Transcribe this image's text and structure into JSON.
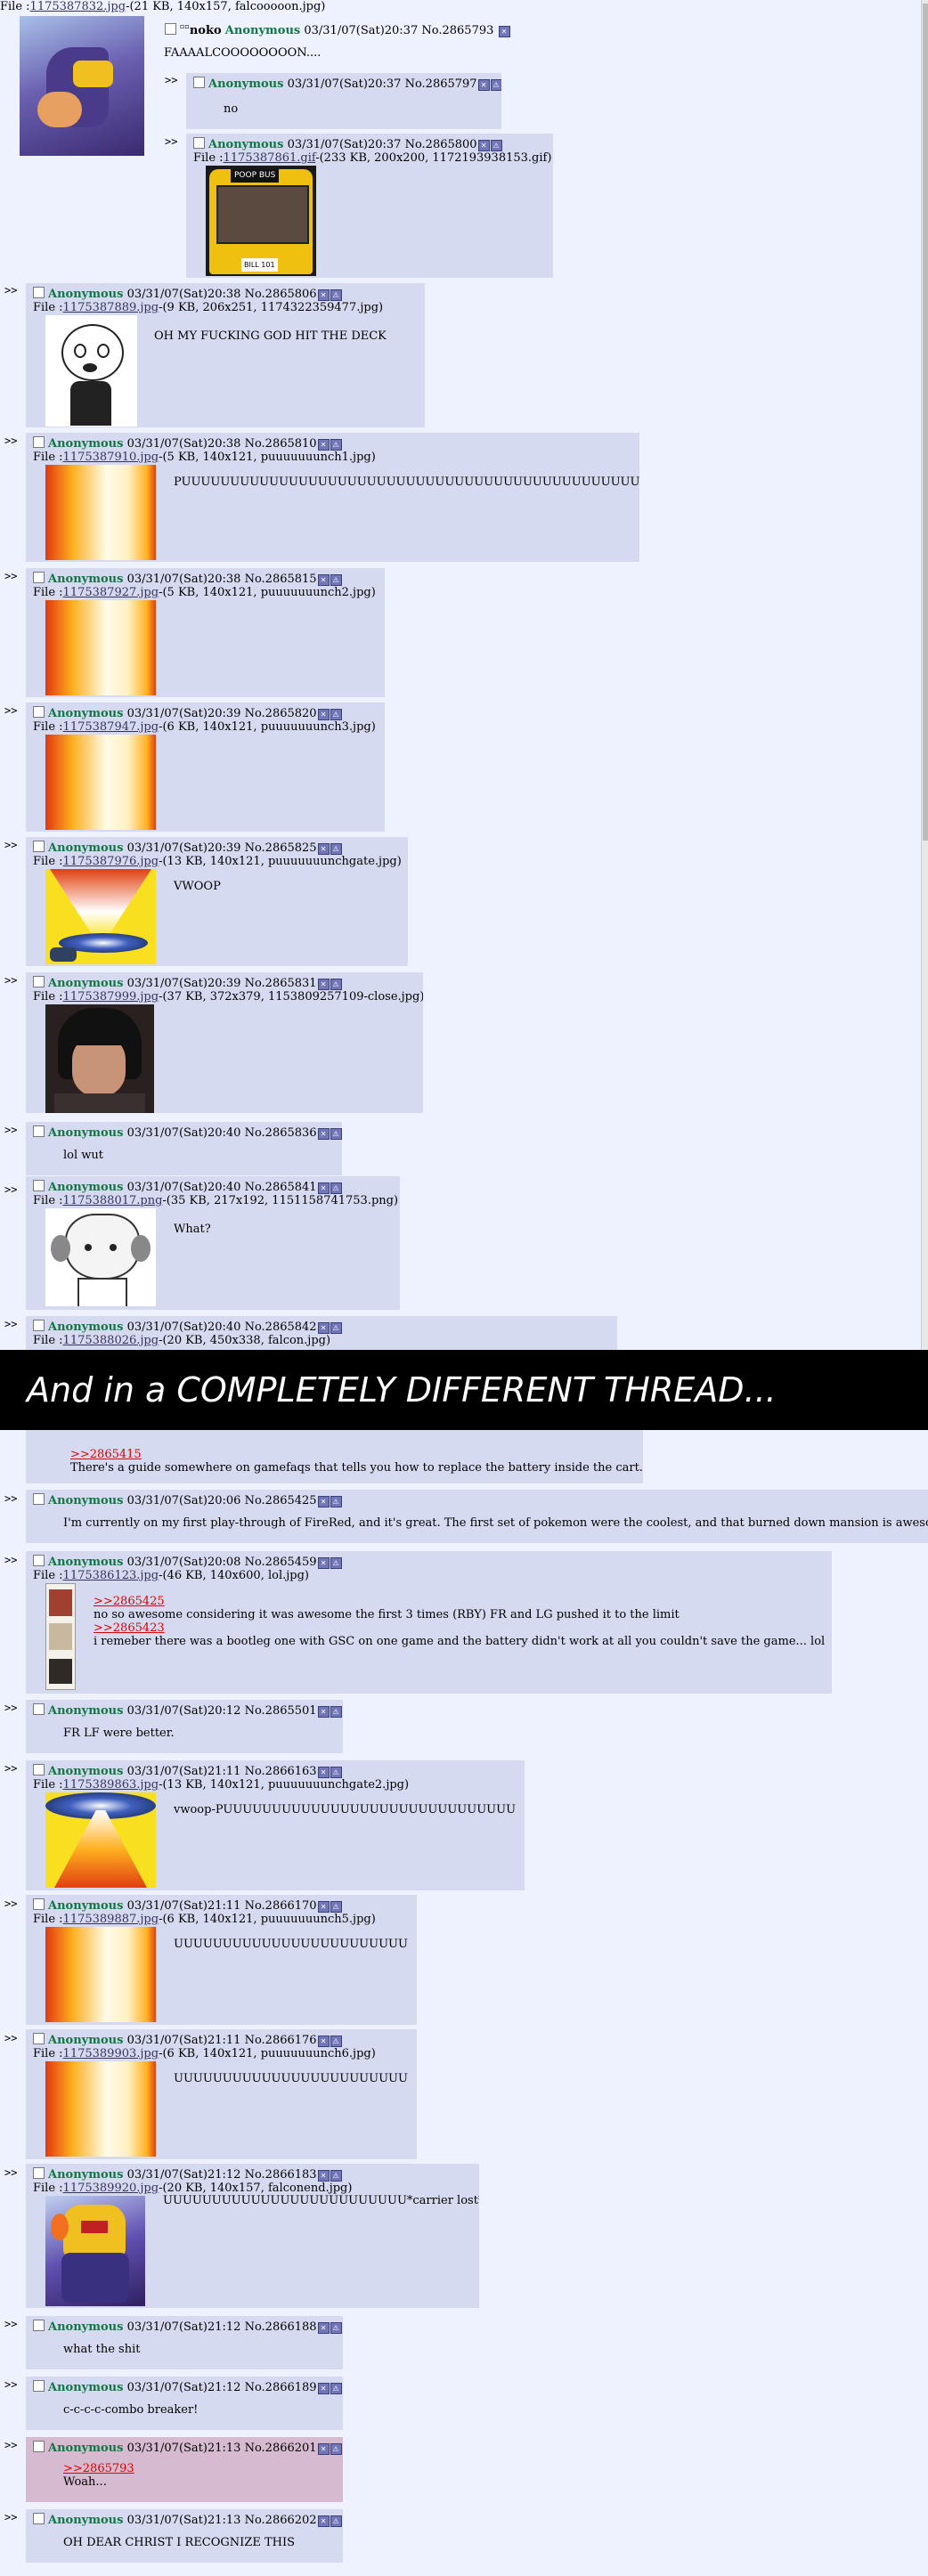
{
  "op": {
    "file_prefix": "File :",
    "file_link": "1175387832.jpg",
    "file_info": "-(21 KB, 140x157, falcooooon.jpg)",
    "noko": "noko",
    "name": "Anonymous",
    "date": "03/31/07(Sat)20:37",
    "no": "No.2865793",
    "message": "FAAAALCOOOOOOOON...."
  },
  "icons": {
    "delete": "delete-icon",
    "report": "report-icon"
  },
  "arrows": ">>",
  "colors": {
    "background": "#eef2ff",
    "reply": "#d6daf0",
    "highlight": "#d6bad0",
    "name": "#117743",
    "link": "#34345c",
    "quote": "#dd0000"
  },
  "banner": "And in a COMPLETELY DIFFERENT THREAD...",
  "replies": [
    {
      "name": "Anonymous",
      "date": "03/31/07(Sat)20:37",
      "no": "No.2865797",
      "file_prefix": "",
      "file_link": "",
      "file_info": "",
      "quotes": [],
      "message": "no"
    },
    {
      "name": "Anonymous",
      "date": "03/31/07(Sat)20:37",
      "no": "No.2865800",
      "file_prefix": "File :",
      "file_link": "1175387861.gif",
      "file_info": "-(233 KB, 200x200, 1172193938153.gif)",
      "quotes": [],
      "message": "",
      "image_text_top": "POOP BUS",
      "image_text_bottom": "BILL 101"
    },
    {
      "name": "Anonymous",
      "date": "03/31/07(Sat)20:38",
      "no": "No.2865806",
      "file_prefix": "File :",
      "file_link": "1175387889.jpg",
      "file_info": "-(9 KB, 206x251, 1174322359477.jpg)",
      "quotes": [],
      "message": "OH MY FUCKING GOD HIT THE DECK"
    },
    {
      "name": "Anonymous",
      "date": "03/31/07(Sat)20:38",
      "no": "No.2865810",
      "file_prefix": "File :",
      "file_link": "1175387910.jpg",
      "file_info": "-(5 KB, 140x121, puuuuuuunch1.jpg)",
      "quotes": [],
      "message": "PUUUUUUUUUUUUUUUUUUUUUUUUUUUUUUUUUUUUUUUUUUUUUUUUUU"
    },
    {
      "name": "Anonymous",
      "date": "03/31/07(Sat)20:38",
      "no": "No.2865815",
      "file_prefix": "File :",
      "file_link": "1175387927.jpg",
      "file_info": "-(5 KB, 140x121, puuuuuuunch2.jpg)",
      "quotes": [],
      "message": ""
    },
    {
      "name": "Anonymous",
      "date": "03/31/07(Sat)20:39",
      "no": "No.2865820",
      "file_prefix": "File :",
      "file_link": "1175387947.jpg",
      "file_info": "-(6 KB, 140x121, puuuuuuunch3.jpg)",
      "quotes": [],
      "message": ""
    },
    {
      "name": "Anonymous",
      "date": "03/31/07(Sat)20:39",
      "no": "No.2865825",
      "file_prefix": "File :",
      "file_link": "1175387976.jpg",
      "file_info": "-(13 KB, 140x121, puuuuuuunchgate.jpg)",
      "quotes": [],
      "message": "VWOOP"
    },
    {
      "name": "Anonymous",
      "date": "03/31/07(Sat)20:39",
      "no": "No.2865831",
      "file_prefix": "File :",
      "file_link": "1175387999.jpg",
      "file_info": "-(37 KB, 372x379, 1153809257109-close.jpg)",
      "quotes": [],
      "message": ""
    },
    {
      "name": "Anonymous",
      "date": "03/31/07(Sat)20:40",
      "no": "No.2865836",
      "file_prefix": "",
      "file_link": "",
      "file_info": "",
      "quotes": [],
      "message": "lol wut"
    },
    {
      "name": "Anonymous",
      "date": "03/31/07(Sat)20:40",
      "no": "No.2865841",
      "file_prefix": "File :",
      "file_link": "1175388017.png",
      "file_info": "-(35 KB, 217x192, 1151158741753.png)",
      "quotes": [],
      "message": "What?"
    },
    {
      "name": "Anonymous",
      "date": "03/31/07(Sat)20:40",
      "no": "No.2865842",
      "file_prefix": "File :",
      "file_link": "1175388026.jpg",
      "file_info": "-(20 KB, 450x338, falcon.jpg)",
      "quotes": [],
      "message": ""
    },
    {
      "name": "",
      "date": "",
      "no": "",
      "file_prefix": "",
      "file_link": "",
      "file_info": "",
      "quotes": [
        ">>2865415"
      ],
      "message": "There's a guide somewhere on gamefaqs that tells you how to replace the battery inside the cart."
    },
    {
      "name": "Anonymous",
      "date": "03/31/07(Sat)20:06",
      "no": "No.2865425",
      "file_prefix": "",
      "file_link": "",
      "file_info": "",
      "quotes": [],
      "message": "I'm currently on my first play-through of FireRed, and it's great. The first set of pokemon were the coolest, and that burned down mansion is awesome."
    },
    {
      "name": "Anonymous",
      "date": "03/31/07(Sat)20:08",
      "no": "No.2865459",
      "file_prefix": "File :",
      "file_link": "1175386123.jpg",
      "file_info": "-(46 KB, 140x600, lol.jpg)",
      "quotes": [
        ">>2865425",
        ">>2865423"
      ],
      "message": "no so awesome considering it was awesome the first 3 times (RBY) FR and LG pushed it to the limit",
      "message2": "i remeber there was a bootleg one with GSC on one game and the battery didn't work at all you couldn't save the game... lol"
    },
    {
      "name": "Anonymous",
      "date": "03/31/07(Sat)20:12",
      "no": "No.2865501",
      "file_prefix": "",
      "file_link": "",
      "file_info": "",
      "quotes": [],
      "message": "FR LF were better."
    },
    {
      "name": "Anonymous",
      "date": "03/31/07(Sat)21:11",
      "no": "No.2866163",
      "file_prefix": "File :",
      "file_link": "1175389863.jpg",
      "file_info": "-(13 KB, 140x121, puuuuuuunchgate2.jpg)",
      "quotes": [],
      "message": "vwoop-PUUUUUUUUUUUUUUUUUUUUUUUUUUUUUU"
    },
    {
      "name": "Anonymous",
      "date": "03/31/07(Sat)21:11",
      "no": "No.2866170",
      "file_prefix": "File :",
      "file_link": "1175389887.jpg",
      "file_info": "-(6 KB, 140x121, puuuuuuunch5.jpg)",
      "quotes": [],
      "message": "UUUUUUUUUUUUUUUUUUUUUUUU"
    },
    {
      "name": "Anonymous",
      "date": "03/31/07(Sat)21:11",
      "no": "No.2866176",
      "file_prefix": "File :",
      "file_link": "1175389903.jpg",
      "file_info": "-(6 KB, 140x121, puuuuuuunch6.jpg)",
      "quotes": [],
      "message": "UUUUUUUUUUUUUUUUUUUUUUUU"
    },
    {
      "name": "Anonymous",
      "date": "03/31/07(Sat)21:12",
      "no": "No.2866183",
      "file_prefix": "File :",
      "file_link": "1175389920.jpg",
      "file_info": "-(20 KB, 140x157, falconend.jpg)",
      "quotes": [],
      "message": "UUUUUUUUUUUUUUUUUUUUUUUUU*carrier lost*"
    },
    {
      "name": "Anonymous",
      "date": "03/31/07(Sat)21:12",
      "no": "No.2866188",
      "file_prefix": "",
      "file_link": "",
      "file_info": "",
      "quotes": [],
      "message": "what the shit"
    },
    {
      "name": "Anonymous",
      "date": "03/31/07(Sat)21:12",
      "no": "No.2866189",
      "file_prefix": "",
      "file_link": "",
      "file_info": "",
      "quotes": [],
      "message": "c-c-c-c-combo breaker!"
    },
    {
      "name": "Anonymous",
      "date": "03/31/07(Sat)21:13",
      "no": "No.2866201",
      "file_prefix": "",
      "file_link": "",
      "file_info": "",
      "quotes": [
        ">>2865793"
      ],
      "message": "Woah..."
    },
    {
      "name": "Anonymous",
      "date": "03/31/07(Sat)21:13",
      "no": "No.2866202",
      "file_prefix": "",
      "file_link": "",
      "file_info": "",
      "quotes": [],
      "message": "OH DEAR CHRIST I RECOGNIZE THIS"
    }
  ]
}
